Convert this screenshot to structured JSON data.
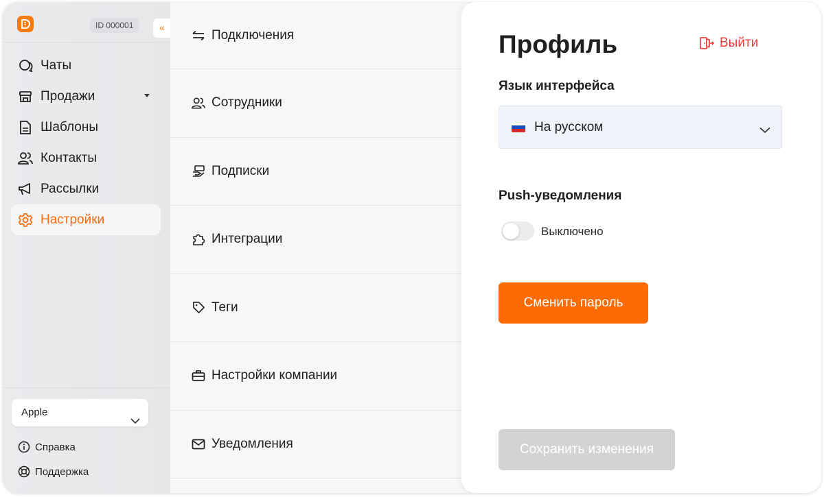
{
  "header": {
    "account_id": "ID 000001",
    "collapse_glyph": "«"
  },
  "sidebar": {
    "items": [
      {
        "label": "Чаты",
        "icon": "chat-icon"
      },
      {
        "label": "Продажи",
        "icon": "store-icon",
        "has_dropdown": true
      },
      {
        "label": "Шаблоны",
        "icon": "document-icon"
      },
      {
        "label": "Контакты",
        "icon": "contacts-icon"
      },
      {
        "label": "Рассылки",
        "icon": "megaphone-icon"
      },
      {
        "label": "Настройки",
        "icon": "gear-icon",
        "active": true
      }
    ],
    "company_select": {
      "value": "Apple"
    },
    "help_links": [
      {
        "label": "Справка",
        "icon": "info-icon"
      },
      {
        "label": "Поддержка",
        "icon": "lifebuoy-icon"
      }
    ]
  },
  "settings_menu": {
    "items": [
      {
        "label": "Подключения",
        "icon": "swap-arrows-icon"
      },
      {
        "label": "Сотрудники",
        "icon": "users-icon"
      },
      {
        "label": "Подписки",
        "icon": "money-hand-icon"
      },
      {
        "label": "Интеграции",
        "icon": "puzzle-icon"
      },
      {
        "label": "Теги",
        "icon": "tag-icon"
      },
      {
        "label": "Настройки компании",
        "icon": "briefcase-icon"
      },
      {
        "label": "Уведомления",
        "icon": "mail-icon"
      }
    ]
  },
  "profile": {
    "title": "Профиль",
    "logout_label": "Выйти",
    "language_label": "Язык интерфейса",
    "language_value": "На русском",
    "push_label": "Push-уведомления",
    "push_status": "Выключено",
    "push_enabled": false,
    "change_password_label": "Сменить пароль",
    "save_label": "Сохранить изменения"
  },
  "colors": {
    "accent": "#fd6c04",
    "danger": "#ef3a3a",
    "disabled": "#d3d3d6",
    "sidebar_bg": "#ebebee"
  }
}
